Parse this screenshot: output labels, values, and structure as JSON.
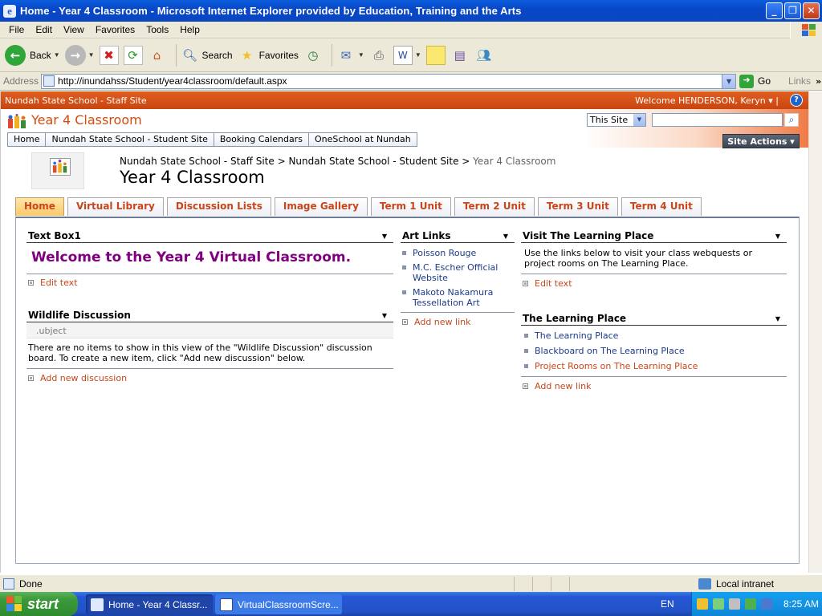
{
  "window": {
    "title": "Home - Year 4 Classroom - Microsoft Internet Explorer provided by Education, Training and the Arts"
  },
  "menubar": [
    "File",
    "Edit",
    "View",
    "Favorites",
    "Tools",
    "Help"
  ],
  "toolbar": {
    "back": "Back",
    "search": "Search",
    "favorites": "Favorites"
  },
  "address": {
    "label": "Address",
    "url": "http://inundahss/Student/year4classroom/default.aspx",
    "go": "Go",
    "links": "Links"
  },
  "sharepoint": {
    "global_site": "Nundah State School - Staff Site",
    "welcome": "Welcome HENDERSON, Keryn ▾  |",
    "site_title": "Year 4 Classroom",
    "search_scope": "This Site",
    "search_value": "",
    "top_nav": [
      "Home",
      "Nundah State School - Student Site",
      "Booking Calendars",
      "OneSchool at Nundah"
    ],
    "site_actions": "Site Actions ▾",
    "breadcrumb": {
      "part1": "Nundah State School - Staff Site",
      "sep": " > ",
      "part2": "Nundah State School - Student Site",
      "current": "Year 4 Classroom"
    },
    "page_title": "Year 4 Classroom",
    "tabs": [
      {
        "label": "Home",
        "active": true
      },
      {
        "label": "Virtual Library",
        "active": false
      },
      {
        "label": "Discussion Lists",
        "active": false
      },
      {
        "label": "Image Gallery",
        "active": false
      },
      {
        "label": "Term 1 Unit",
        "active": false
      },
      {
        "label": "Term 2 Unit",
        "active": false
      },
      {
        "label": "Term 3 Unit",
        "active": false
      },
      {
        "label": "Term 4 Unit",
        "active": false
      }
    ]
  },
  "webparts": {
    "textbox": {
      "title": "Text Box1",
      "welcome": "Welcome to the Year 4 Virtual Classroom.",
      "edit": "Edit text"
    },
    "discussion": {
      "title": "Wildlife Discussion",
      "column": ".ubject",
      "empty": "There are no items to show in this view of the \"Wildlife Discussion\" discussion board. To create a new item, click \"Add new discussion\" below.",
      "add": "Add new discussion"
    },
    "artlinks": {
      "title": "Art Links",
      "links": [
        "Poisson Rouge",
        "M.C. Escher Official Website",
        "Makoto Nakamura Tessellation Art"
      ],
      "add": "Add new link"
    },
    "visit": {
      "title": "Visit The Learning Place",
      "body": "Use the links below to visit your class webquests or project rooms on The Learning Place.",
      "edit": "Edit text"
    },
    "learningplace": {
      "title": "The Learning Place",
      "links": [
        "The Learning Place",
        "Blackboard on The Learning Place",
        "Project Rooms on The Learning Place"
      ],
      "add": "Add new link"
    }
  },
  "statusbar": {
    "status": "Done",
    "zone": "Local intranet"
  },
  "taskbar": {
    "start": "start",
    "items": [
      "Home - Year 4 Classr...",
      "VirtualClassroomScre..."
    ],
    "lang": "EN",
    "time": "8:25 AM"
  }
}
